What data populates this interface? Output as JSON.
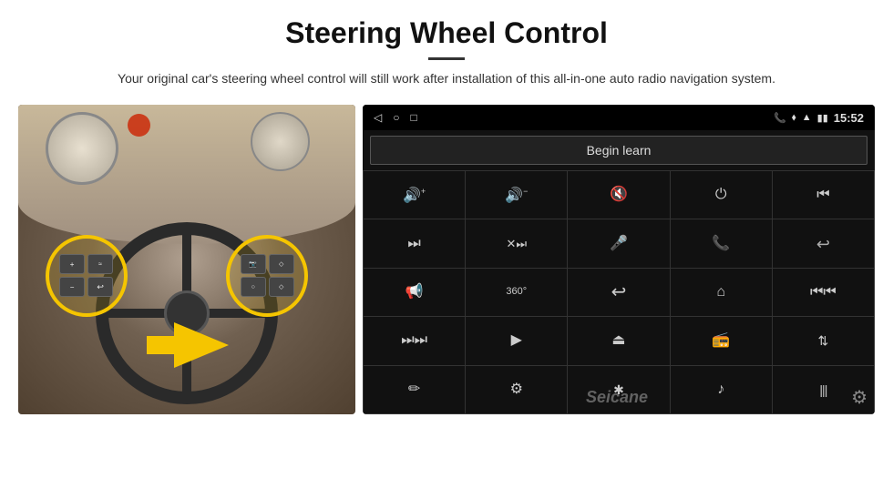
{
  "header": {
    "title": "Steering Wheel Control",
    "subtitle": "Your original car's steering wheel control will still work after installation of this all-in-one auto radio navigation system."
  },
  "statusbar": {
    "time": "15:52",
    "nav_icons": [
      "◁",
      "○",
      "□"
    ],
    "status_icons": [
      "📞",
      "⬧",
      "▲",
      "▮▮"
    ]
  },
  "begin_learn": {
    "label": "Begin learn"
  },
  "control_buttons": [
    {
      "icon": "🔊+",
      "label": "vol-up"
    },
    {
      "icon": "🔊-",
      "label": "vol-down"
    },
    {
      "icon": "🔇",
      "label": "mute"
    },
    {
      "icon": "⏻",
      "label": "power"
    },
    {
      "icon": "⏮",
      "label": "prev-track"
    },
    {
      "icon": "⏭",
      "label": "next"
    },
    {
      "icon": "⏭⏭",
      "label": "fast-forward"
    },
    {
      "icon": "🎤",
      "label": "mic"
    },
    {
      "icon": "📞",
      "label": "phone"
    },
    {
      "icon": "📞-",
      "label": "hang-up"
    },
    {
      "icon": "📢",
      "label": "speaker"
    },
    {
      "icon": "360",
      "label": "camera"
    },
    {
      "icon": "↩",
      "label": "back"
    },
    {
      "icon": "⌂",
      "label": "home"
    },
    {
      "icon": "⏮⏮",
      "label": "rewind"
    },
    {
      "icon": "⏭",
      "label": "skip-next"
    },
    {
      "icon": "▶",
      "label": "navigate"
    },
    {
      "icon": "⏏",
      "label": "eject"
    },
    {
      "icon": "📻",
      "label": "radio"
    },
    {
      "icon": "⇅",
      "label": "settings-eq"
    },
    {
      "icon": "✏",
      "label": "pen"
    },
    {
      "icon": "⚙",
      "label": "settings2"
    },
    {
      "icon": "✱",
      "label": "bluetooth"
    },
    {
      "icon": "♪",
      "label": "music"
    },
    {
      "icon": "|||",
      "label": "equalizer"
    }
  ],
  "watermark": "Seicane",
  "gear_icon": "⚙"
}
